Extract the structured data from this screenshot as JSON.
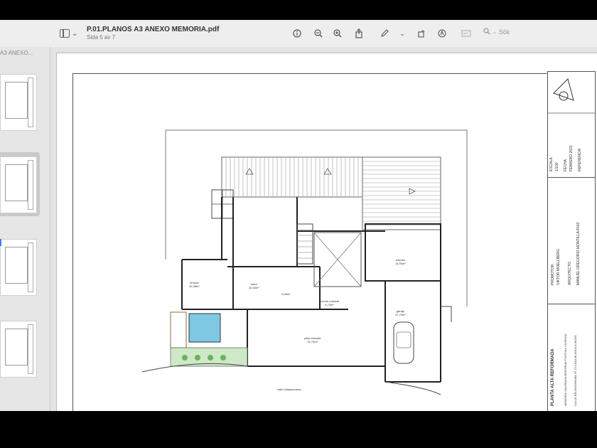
{
  "toolbar": {
    "document_title": "P.01.PLANOS A3 ANEXO MEMORIA.pdf",
    "page_indicator": "Sida 5 av 7",
    "search_placeholder": "Sök",
    "icons": [
      "sidebar-icon",
      "info-icon",
      "zoom-out-icon",
      "zoom-in-icon",
      "share-icon",
      "markup-pen-icon",
      "rotate-icon",
      "annotate-icon",
      "form-icon",
      "search-icon"
    ]
  },
  "sidebar": {
    "title": "A3 ANEXO..."
  },
  "plan": {
    "rooms": {
      "terraza": "terraza",
      "terraza_area": "32,38m²",
      "salon": "salon",
      "salon_area": "10,43m²",
      "bath_area": "2,58m²",
      "porche": "porche entrada",
      "porche_area": "6,73m²",
      "estudio": "estudio",
      "estudio_area": "14,90m²",
      "garaje": "garaje",
      "garaje_area": "37,70m²",
      "patio": "patio entrada",
      "patio_area": "31,70m²",
      "calle": "calle bellpanorama"
    }
  },
  "title_block": {
    "escala_label": "ESCALA",
    "escala": "1/100",
    "fecha_label": "FECHA",
    "fecha": "FEBRERO 2021",
    "ref_label": "REFERENCIA",
    "promotor_label": "PROMOTOR:",
    "promotor": "VIKTOR MOELLBERG",
    "arquitecto_label": "ARQUITECTO:",
    "arquitecto": "MANUEL GREGORIO MONTILLA RUIZ",
    "plano": "PLANTA ALTA REFORMADA",
    "memoria": "MEMORIA VALORADA REFORMA PUNTUAL VIVIENDA",
    "direccion": "CALLE BELPANORAMA Nº 23 CASA BLANCA A MIJAS"
  }
}
